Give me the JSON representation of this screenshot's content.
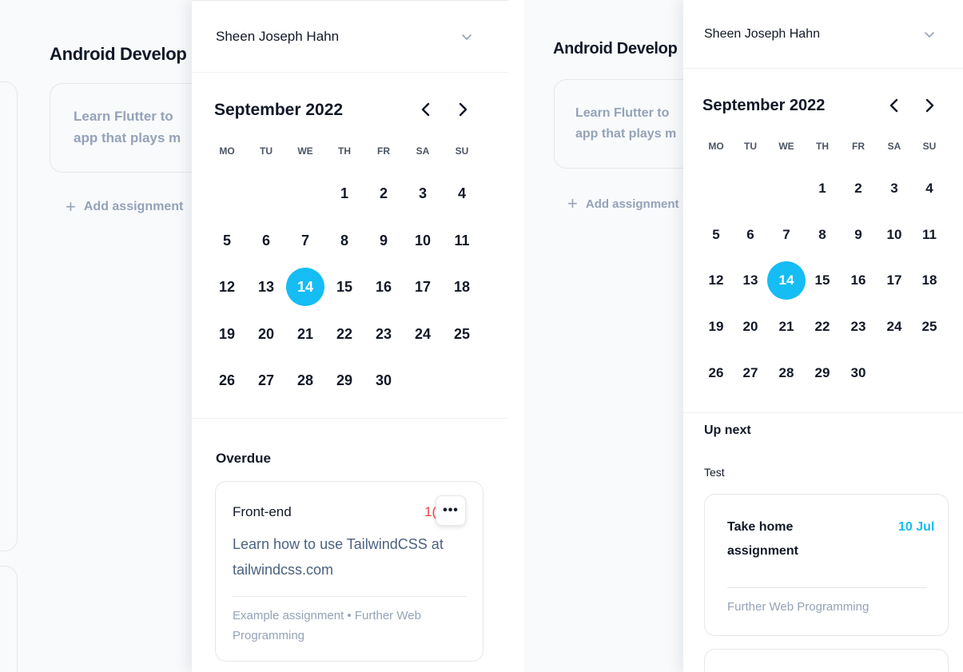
{
  "colors": {
    "accent": "#15bdf4",
    "overdue": "#ef4444",
    "muted": "#94a3b8"
  },
  "board": {
    "column_title": "Android Develop",
    "card_text_line1": "Learn Flutter to",
    "card_text_line2": "app that plays m",
    "add_assignment_label": "Add assignment"
  },
  "panel": {
    "user_name": "Sheen Joseph Hahn",
    "calendar": {
      "month_label": "September 2022",
      "prev_icon": "chevron-left-icon",
      "next_icon": "chevron-right-icon",
      "weekdays": [
        "MO",
        "TU",
        "WE",
        "TH",
        "FR",
        "SA",
        "SU"
      ],
      "days": [
        "1",
        "2",
        "3",
        "4",
        "5",
        "6",
        "7",
        "8",
        "9",
        "10",
        "11",
        "12",
        "13",
        "14",
        "15",
        "16",
        "17",
        "18",
        "19",
        "20",
        "21",
        "22",
        "23",
        "24",
        "25",
        "26",
        "27",
        "28",
        "29",
        "30"
      ],
      "selected_day": "14"
    }
  },
  "left_view": {
    "section_title": "Overdue",
    "card": {
      "name": "Front-end",
      "date_partial": "1(",
      "description_line1": "Learn how to use TailwindCSS at",
      "description_line2": "tailwindcss.com",
      "meta_line1": "Example assignment • Further Web",
      "meta_line2": "Programming",
      "more_label": "•••"
    }
  },
  "right_view": {
    "section_title": "Up next",
    "group_label": "Test",
    "card": {
      "name_line1": "Take home",
      "name_line2": "assignment",
      "date": "10 Jul",
      "meta": "Further Web Programming"
    }
  }
}
